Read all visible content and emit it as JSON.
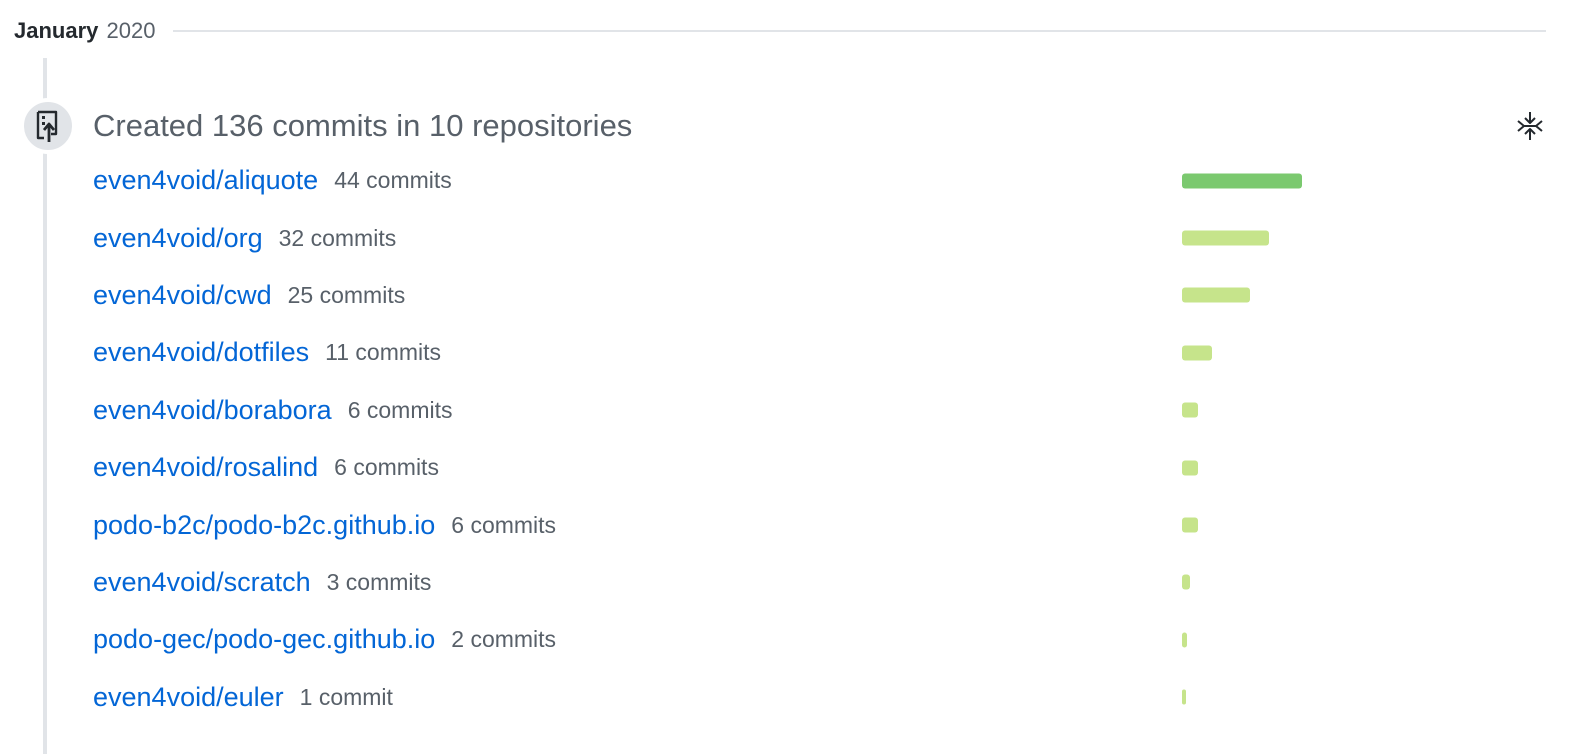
{
  "month": {
    "name": "January",
    "year": "2020"
  },
  "event": {
    "icon": "repo-push-icon",
    "title": "Created 136 commits in 10 repositories",
    "collapse_icon": "fold-icon"
  },
  "colors": {
    "link": "#0366d6",
    "bar_top": "#7bc96f",
    "bar": "#c6e48b",
    "muted": "#586069",
    "timeline": "#e1e4e8"
  },
  "repositories": [
    {
      "name": "even4void/aliquote",
      "count_label": "44 commits",
      "commits": 44
    },
    {
      "name": "even4void/org",
      "count_label": "32 commits",
      "commits": 32
    },
    {
      "name": "even4void/cwd",
      "count_label": "25 commits",
      "commits": 25
    },
    {
      "name": "even4void/dotfiles",
      "count_label": "11 commits",
      "commits": 11
    },
    {
      "name": "even4void/borabora",
      "count_label": "6 commits",
      "commits": 6
    },
    {
      "name": "even4void/rosalind",
      "count_label": "6 commits",
      "commits": 6
    },
    {
      "name": "podo-b2c/podo-b2c.github.io",
      "count_label": "6 commits",
      "commits": 6
    },
    {
      "name": "even4void/scratch",
      "count_label": "3 commits",
      "commits": 3
    },
    {
      "name": "podo-gec/podo-gec.github.io",
      "count_label": "2 commits",
      "commits": 2
    },
    {
      "name": "even4void/euler",
      "count_label": "1 commit",
      "commits": 1
    }
  ]
}
